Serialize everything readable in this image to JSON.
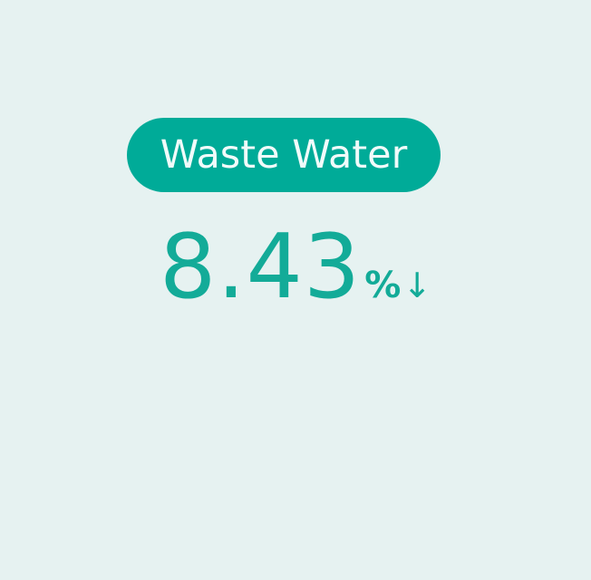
{
  "stat": {
    "label": "Waste Water",
    "value": "8.43",
    "unit": "%",
    "trend_symbol": "↓",
    "trend": "down"
  },
  "colors": {
    "background": "#e6f2f1",
    "accent": "#00ab98",
    "label_text": "#f1fbfa",
    "value_text": "#13ab98"
  },
  "icons": {
    "trend": "arrow-down-icon"
  }
}
